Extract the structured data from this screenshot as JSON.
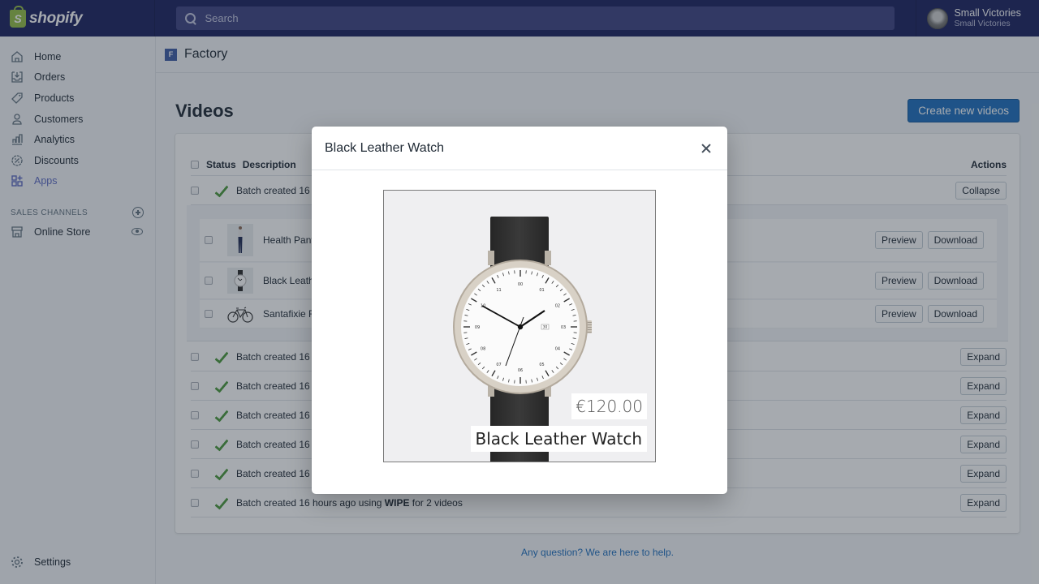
{
  "topbar": {
    "brand": "shopify",
    "search_placeholder": "Search",
    "user_name": "Small Victories",
    "shop_name": "Small Victories"
  },
  "sidebar": {
    "items": [
      {
        "label": "Home",
        "icon": "home-icon"
      },
      {
        "label": "Orders",
        "icon": "orders-icon"
      },
      {
        "label": "Products",
        "icon": "tag-icon"
      },
      {
        "label": "Customers",
        "icon": "person-icon"
      },
      {
        "label": "Analytics",
        "icon": "bar-chart-icon"
      },
      {
        "label": "Discounts",
        "icon": "discount-icon"
      },
      {
        "label": "Apps",
        "icon": "apps-icon",
        "active": true
      }
    ],
    "sales_channels_label": "SALES CHANNELS",
    "channels": [
      {
        "label": "Online Store",
        "icon": "store-icon"
      }
    ],
    "settings_label": "Settings"
  },
  "app": {
    "logo_letter": "F",
    "name": "Factory"
  },
  "page": {
    "title": "Videos",
    "create_button": "Create new videos",
    "help_link": "Any question? We are here to help."
  },
  "table": {
    "headers": {
      "status": "Status",
      "description": "Description",
      "actions": "Actions"
    },
    "expanded_row": {
      "description": "Batch created 16",
      "action": "Collapse"
    },
    "sub_items": [
      {
        "name": "Health Pants",
        "preview": "Preview",
        "download": "Download",
        "thumb": "pants"
      },
      {
        "name": "Black Leathe",
        "preview": "Preview",
        "download": "Download",
        "thumb": "watch"
      },
      {
        "name": "Santafixie Ra",
        "preview": "Preview",
        "download": "Download",
        "thumb": "bike"
      }
    ],
    "rows": [
      {
        "prefix": "Batch created 16",
        "bold": "",
        "suffix": "",
        "action": "Expand"
      },
      {
        "prefix": "Batch created 16",
        "bold": "",
        "suffix": "",
        "action": "Expand"
      },
      {
        "prefix": "Batch created 16",
        "bold": "",
        "suffix": "",
        "action": "Expand"
      },
      {
        "prefix": "Batch created 16",
        "bold": "",
        "suffix": "",
        "action": "Expand"
      },
      {
        "prefix": "Batch created 16",
        "bold": "",
        "suffix": "",
        "action": "Expand"
      },
      {
        "prefix": "Batch created 16 hours ago using ",
        "bold": "WIPE",
        "suffix": " for 2 videos",
        "action": "Expand"
      }
    ]
  },
  "modal": {
    "title": "Black Leather Watch",
    "price": "€120.00",
    "product_name": "Black Leather Watch",
    "watch_date": "30",
    "dial_numbers": [
      "00",
      "01",
      "02",
      "03",
      "04",
      "05",
      "06",
      "07",
      "08",
      "09",
      "10",
      "11"
    ]
  },
  "colors": {
    "topbar": "#1c2260",
    "accent": "#5c6ac4",
    "primary_button": "#1f6fbe",
    "success": "#4b9a3c"
  }
}
